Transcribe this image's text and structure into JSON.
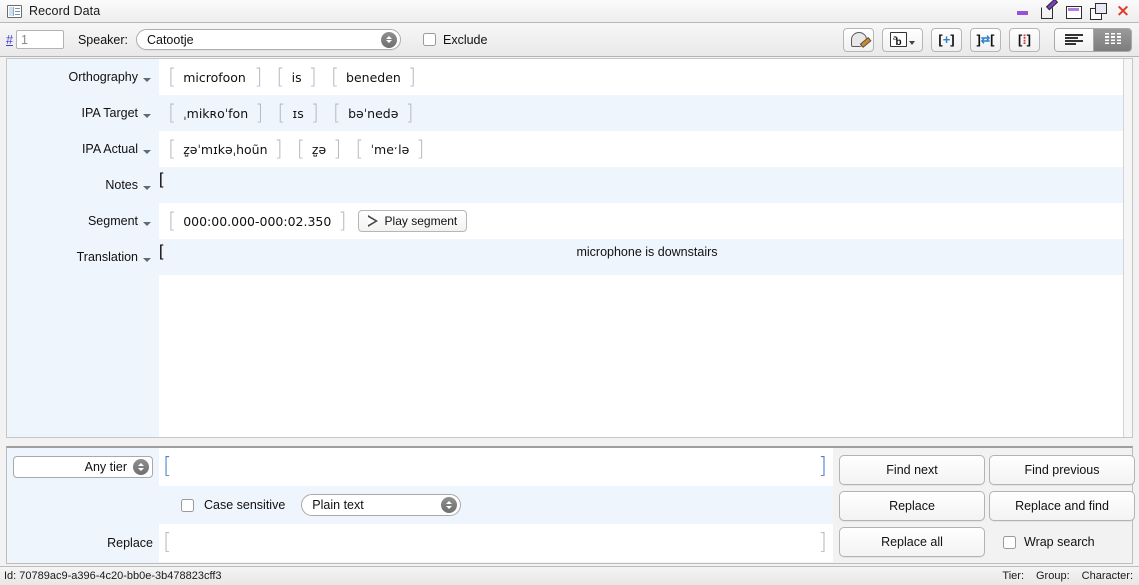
{
  "window": {
    "title": "Record Data",
    "icon": "record-table-icon",
    "controls": [
      {
        "name": "minimize-button",
        "glyph": "minimize"
      },
      {
        "name": "edit-restore-button",
        "glyph": "edit"
      },
      {
        "name": "maximize-button",
        "glyph": "maximize"
      },
      {
        "name": "detach-button",
        "glyph": "float"
      },
      {
        "name": "close-button",
        "glyph": "×"
      }
    ]
  },
  "toolbar": {
    "record_hash": "#",
    "record_number": "1",
    "speaker_label": "Speaker:",
    "speaker_value": "Catootje",
    "exclude_label": "Exclude",
    "exclude_checked": false,
    "buttons": [
      {
        "name": "stamp-icon",
        "title": "blind-transcription"
      },
      {
        "name": "ab-transliterate-icon",
        "title": "transliterate"
      },
      {
        "name": "insert-group-icon",
        "title": "new group"
      },
      {
        "name": "merge-group-icon",
        "title": "merge groups"
      },
      {
        "name": "split-group-icon",
        "title": "split group"
      }
    ],
    "view_modes": [
      {
        "name": "list-view-toggle",
        "selected": false
      },
      {
        "name": "column-view-toggle",
        "selected": true
      }
    ]
  },
  "record": {
    "rows": [
      {
        "label": "Orthography",
        "type": "groups",
        "groups": [
          "microfoon",
          "is",
          "beneden"
        ]
      },
      {
        "label": "IPA Target",
        "type": "groups",
        "groups": [
          "ˌmikʀoˈfon",
          "ɪs",
          "bəˈnedə"
        ]
      },
      {
        "label": "IPA Actual",
        "type": "groups",
        "groups": [
          "z̺əˈmɪkəˌhoũn",
          "z̺ə",
          "ˈmeˑlə"
        ]
      },
      {
        "label": "Notes",
        "type": "full",
        "value": ""
      },
      {
        "label": "Segment",
        "type": "segment",
        "value": "000:00.000-000:02.350",
        "play_label": "Play segment"
      },
      {
        "label": "Translation",
        "type": "full",
        "value": "microphone is downstairs"
      }
    ]
  },
  "search": {
    "tier_value": "Any tier",
    "query": "",
    "case_sensitive_label": "Case sensitive",
    "case_sensitive_checked": false,
    "mode_value": "Plain text",
    "replace_label": "Replace",
    "replace_value": "",
    "wrap_label": "Wrap search",
    "wrap_checked": false,
    "buttons": {
      "find_next": "Find next",
      "find_previous": "Find previous",
      "replace": "Replace",
      "replace_and_find": "Replace and find",
      "replace_all": "Replace all"
    }
  },
  "status": {
    "id_text": "Id: 70789ac9-a396-4c20-bb0e-3b478823cff3",
    "tier": "Tier:",
    "group": "Group:",
    "character": "Character:"
  }
}
